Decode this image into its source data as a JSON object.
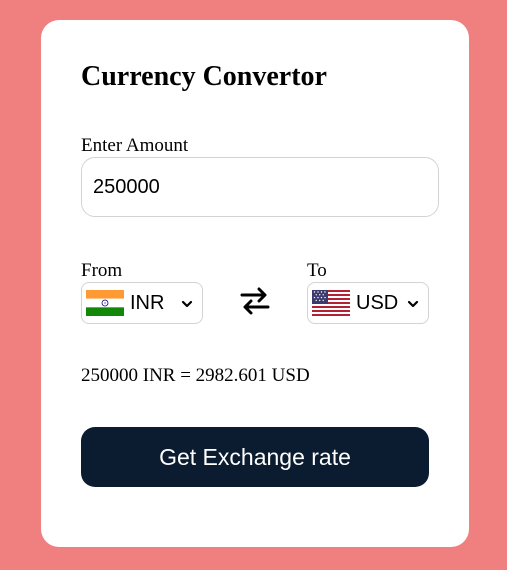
{
  "app": {
    "title": "Currency Convertor"
  },
  "amount": {
    "label": "Enter Amount",
    "value": "250000"
  },
  "from": {
    "label": "From",
    "currency": "INR",
    "flag_icon": "india-flag-icon"
  },
  "to": {
    "label": "To",
    "currency": "USD",
    "flag_icon": "usa-flag-icon"
  },
  "swap": {
    "icon": "swap-arrows-icon"
  },
  "result": {
    "text": "250000 INR = 2982.601 USD"
  },
  "button": {
    "label": "Get Exchange rate"
  },
  "colors": {
    "background": "#f08080",
    "card": "#ffffff",
    "button": "#0b1b30",
    "border": "#d3d3d3"
  }
}
